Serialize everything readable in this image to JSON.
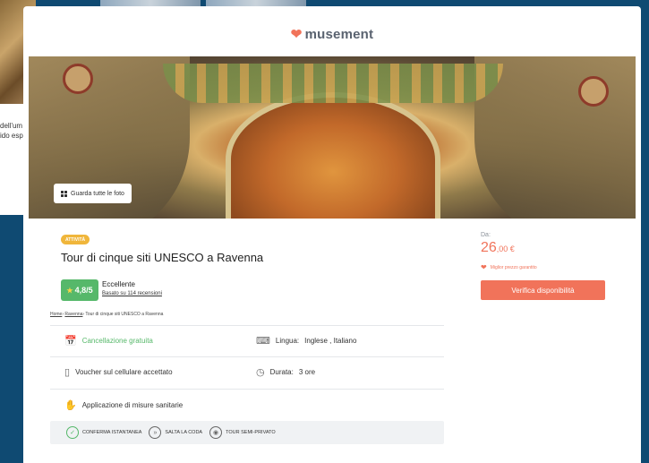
{
  "background": {
    "snippet_line1": "dell'um",
    "snippet_line2": "ido esp"
  },
  "header": {
    "brand": "musement",
    "brand_icon": "heart-logo-icon"
  },
  "gallery": {
    "view_all_label": "Guarda tutte le foto"
  },
  "activity": {
    "category_badge": "ATTIVITÀ",
    "title": "Tour di cinque siti UNESCO a Ravenna",
    "rating": {
      "score": "4,8/5",
      "label": "Eccellente",
      "reviews": "Basato su 114 recensioni"
    },
    "breadcrumb": {
      "home": "Home",
      "sep": "›",
      "city": "Ravenna",
      "current": "Tour di cinque siti UNESCO a Ravenna"
    },
    "features": {
      "cancellation": "Cancellazione gratuita",
      "language_label": "Lingua:",
      "language_value": "Inglese , Italiano",
      "voucher": "Voucher sul cellulare accettato",
      "duration_label": "Durata:",
      "duration_value": "3 ore",
      "sanitary": "Applicazione di misure sanitarie"
    },
    "tags": [
      "CONFERMA ISTANTANEA",
      "SALTA LA CODA",
      "TOUR SEMI-PRIVATO"
    ]
  },
  "pricing": {
    "from_label": "Da:",
    "price_whole": "26",
    "price_cents": ",00 €",
    "best_price": "Miglior prezzo garantito",
    "cta_label": "Verifica disponibilità"
  },
  "colors": {
    "brand": "#f1735a",
    "rating_green": "#56b86a",
    "badge_yellow": "#f0b63b",
    "page_bg": "#0f4a72"
  }
}
